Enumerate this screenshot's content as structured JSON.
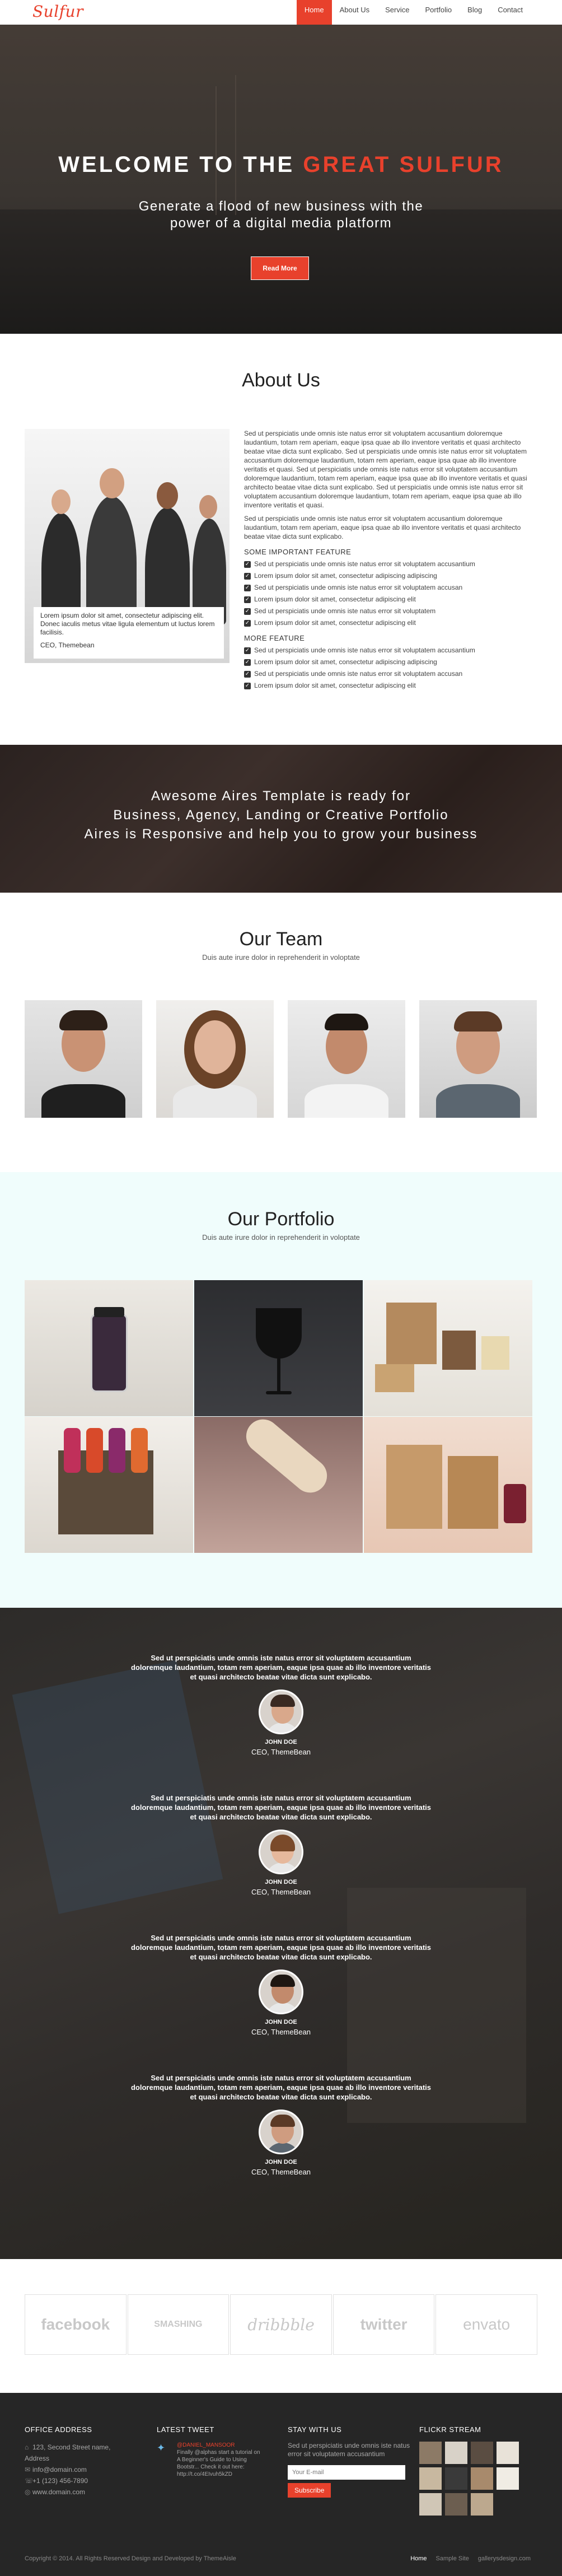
{
  "brand": {
    "logo": "Sulfur",
    "accent": "#e8412c"
  },
  "nav": {
    "items": [
      {
        "label": "Home",
        "active": true
      },
      {
        "label": "About Us",
        "active": false
      },
      {
        "label": "Service",
        "active": false
      },
      {
        "label": "Portfolio",
        "active": false
      },
      {
        "label": "Blog",
        "active": false
      },
      {
        "label": "Contact",
        "active": false
      }
    ]
  },
  "hero": {
    "title_prefix": "WELCOME TO THE ",
    "title_accent": "GREAT SULFUR",
    "subtitle_line1": "Generate a flood of new business with the",
    "subtitle_line2": "power of a digital media platform",
    "button": "Read More"
  },
  "about": {
    "title": "About Us",
    "caption_text": "Lorem ipsum dolor sit amet, consectetur adipiscing elit. Donec iaculis metus vitae ligula elementum ut luctus lorem facilisis.",
    "caption_who": "CEO, Themebean",
    "para1": "Sed ut perspiciatis unde omnis iste natus error sit voluptatem accusantium doloremque laudantium, totam rem aperiam, eaque ipsa quae ab illo inventore veritatis et quasi architecto beatae vitae dicta sunt explicabo. Sed ut perspiciatis unde omnis iste natus error sit voluptatem accusantium doloremque laudantium, totam rem aperiam, eaque ipsa quae ab illo inventore veritatis et quasi. Sed ut perspiciatis unde omnis iste natus error sit voluptatem accusantium doloremque laudantium, totam rem aperiam, eaque ipsa quae ab illo inventore veritatis et quasi architecto beatae vitae dicta sunt explicabo. Sed ut perspiciatis unde omnis iste natus error sit voluptatem accusantium doloremque laudantium, totam rem aperiam, eaque ipsa quae ab illo inventore veritatis et quasi.",
    "para2": "Sed ut perspiciatis unde omnis iste natus error sit voluptatem accusantium doloremque laudantium, totam rem aperiam, eaque ipsa quae ab illo inventore veritatis et quasi architecto beatae vitae dicta sunt explicabo.",
    "feature1_title": "SOME IMPORTANT FEATURE",
    "feature1_items": [
      "Sed ut perspiciatis unde omnis iste natus error sit voluptatem accusantium",
      "Lorem ipsum dolor sit amet, consectetur adipiscing adipiscing",
      "Sed ut perspiciatis unde omnis iste natus error sit voluptatem accusan",
      "Lorem ipsum dolor sit amet, consectetur adipiscing elit",
      "Sed ut perspiciatis unde omnis iste natus error sit voluptatem",
      "Lorem ipsum dolor sit amet, consectetur adipiscing elit"
    ],
    "feature2_title": "MORE FEATURE",
    "feature2_items": [
      "Sed ut perspiciatis unde omnis iste natus error sit voluptatem accusantium",
      "Lorem ipsum dolor sit amet, consectetur adipiscing adipiscing",
      "Sed ut perspiciatis unde omnis iste natus error sit voluptatem accusan",
      "Lorem ipsum dolor sit amet, consectetur adipiscing elit"
    ]
  },
  "banner": {
    "line1": "Awesome Aires Template is ready for",
    "line2": "Business, Agency, Landing or Creative Portfolio",
    "line3": "Aires is Responsive and help you to grow your business"
  },
  "team": {
    "title": "Our Team",
    "subtitle": "Duis aute irure dolor in reprehenderit in voloptate"
  },
  "portfolio": {
    "title": "Our Portfolio",
    "subtitle": "Duis aute irure dolor in reprehenderit in voloptate"
  },
  "testimonials": [
    {
      "quote": "Sed ut perspiciatis unde omnis iste natus error sit voluptatem accusantium doloremque laudantium, totam rem aperiam, eaque ipsa quae ab illo inventore veritatis et quasi architecto beatae vitae dicta sunt explicabo.",
      "name": "JOHN DOE",
      "role": "CEO, ThemeBean"
    },
    {
      "quote": "Sed ut perspiciatis unde omnis iste natus error sit voluptatem accusantium doloremque laudantium, totam rem aperiam, eaque ipsa quae ab illo inventore veritatis et quasi architecto beatae vitae dicta sunt explicabo.",
      "name": "JOHN DOE",
      "role": "CEO, ThemeBean"
    },
    {
      "quote": "Sed ut perspiciatis unde omnis iste natus error sit voluptatem accusantium doloremque laudantium, totam rem aperiam, eaque ipsa quae ab illo inventore veritatis et quasi architecto beatae vitae dicta sunt explicabo.",
      "name": "JOHN DOE",
      "role": "CEO, ThemeBean"
    },
    {
      "quote": "Sed ut perspiciatis unde omnis iste natus error sit voluptatem accusantium doloremque laudantium, totam rem aperiam, eaque ipsa quae ab illo inventore veritatis et quasi architecto beatae vitae dicta sunt explicabo.",
      "name": "JOHN DOE",
      "role": "CEO, ThemeBean"
    }
  ],
  "clients": [
    "facebook",
    "SMASHING",
    "dribbble",
    "twitter",
    "envato"
  ],
  "footer": {
    "office_title": "OFFICE ADDRESS",
    "address1": "123, Second Street name,",
    "address2": "Address",
    "email": "info@domain.com",
    "phone": "+1 (123) 456-7890",
    "web": "www.domain.com",
    "tweet_title": "LATEST TWEET",
    "tweet_user": "@DANIEL_MANSOOR",
    "tweet_text": "Finally @alphas start a tutorial on A Beginner's Guide to Using Bootstr... Check it out here: http://t.co/4EIvuh5kZD",
    "stay_title": "STAY WITH US",
    "stay_text": "Sed ut perspiciatis unde omnis iste natus error sit voluptatem accusantium",
    "email_placeholder": "Your E-mail",
    "subscribe": "Subscribe",
    "flickr_title": "FLICKR STREAM",
    "copyright": "Copyright © 2014. All Rights Reserved Design and Developed by ThemeAisle",
    "links": [
      "Home",
      "Sample Site",
      "gallerysdesign.com"
    ]
  }
}
